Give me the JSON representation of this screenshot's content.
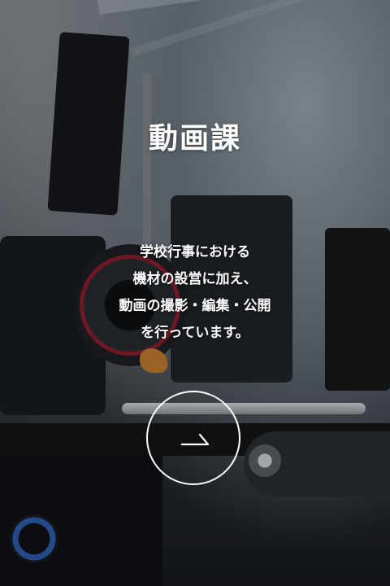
{
  "section": {
    "title": "動画課",
    "description_lines": [
      "学校行事における",
      "機材の設営に加え、",
      "動画の撮影・編集・公開",
      "を行っています。"
    ]
  },
  "icons": {
    "link_arrow": "arrow-right-icon"
  },
  "colors": {
    "text": "#ffffff",
    "button_border": "#ffffff"
  }
}
